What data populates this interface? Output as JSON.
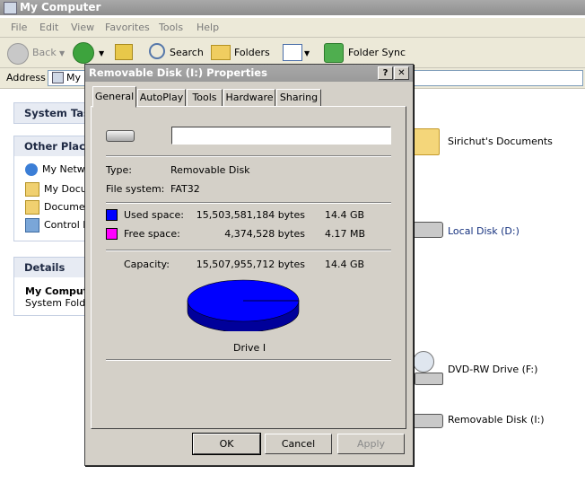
{
  "window": {
    "title": "My Computer"
  },
  "menu": [
    "File",
    "Edit",
    "View",
    "Favorites",
    "Tools",
    "Help"
  ],
  "toolbar": {
    "back_label": "Back",
    "search_label": "Search",
    "folders_label": "Folders",
    "sync_label": "Folder Sync"
  },
  "address": {
    "label": "Address",
    "value": "My"
  },
  "left_pane": {
    "system_tasks": "System Tas",
    "other_places": {
      "title": "Other Place",
      "items": [
        "My Netw",
        "My Docu",
        "Documer",
        "Control P"
      ]
    },
    "details": {
      "title": "Details",
      "name": "My Comput",
      "type": "System Folde"
    }
  },
  "right_pane": {
    "items": [
      "Sirichut's Documents",
      "Local Disk (D:)",
      "DVD-RW Drive (F:)",
      "Removable Disk (I:)"
    ]
  },
  "dialog": {
    "title": "Removable Disk (I:) Properties",
    "help_btn": "?",
    "close_btn": "✕",
    "tabs": [
      "General",
      "AutoPlay",
      "Tools",
      "Hardware",
      "Sharing"
    ],
    "label_value": "",
    "type_label": "Type:",
    "type_value": "Removable Disk",
    "fs_label": "File system:",
    "fs_value": "FAT32",
    "used_label": "Used space:",
    "used_bytes": "15,503,581,184 bytes",
    "used_size": "14.4 GB",
    "free_label": "Free space:",
    "free_bytes": "4,374,528 bytes",
    "free_size": "4.17 MB",
    "capacity_label": "Capacity:",
    "capacity_bytes": "15,507,955,712 bytes",
    "capacity_size": "14.4 GB",
    "drive_label": "Drive I",
    "used_fraction": 0.99972,
    "colors": {
      "used": "#0000ff",
      "free": "#ff00ff"
    },
    "ok": "OK",
    "cancel": "Cancel",
    "apply": "Apply"
  }
}
